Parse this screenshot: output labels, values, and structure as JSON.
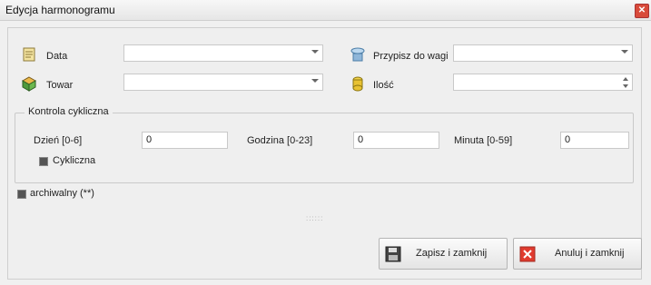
{
  "window": {
    "title": "Edycja harmonogramu",
    "close_icon": "close-icon"
  },
  "form": {
    "data": {
      "label": "Data",
      "value": ""
    },
    "towar": {
      "label": "Towar",
      "value": ""
    },
    "przypisz": {
      "label": "Przypisz do wagi",
      "value": ""
    },
    "ilosc": {
      "label": "Ilość",
      "value": ""
    }
  },
  "cyclic": {
    "title": "Kontrola cykliczna",
    "day": {
      "label": "Dzień [0-6]",
      "value": "0"
    },
    "hour": {
      "label": "Godzina [0-23]",
      "value": "0"
    },
    "minute": {
      "label": "Minuta [0-59]",
      "value": "0"
    },
    "cykliczna_label": "Cykliczna"
  },
  "archive_label": "archiwalny (**)",
  "grip_text": "::::::",
  "buttons": {
    "save": "Zapisz i zamknij",
    "cancel": "Anuluj i zamknij"
  },
  "colors": {
    "close": "#d84a3a",
    "cancel_icon": "#e03b2f",
    "save_icon": "#333333"
  }
}
